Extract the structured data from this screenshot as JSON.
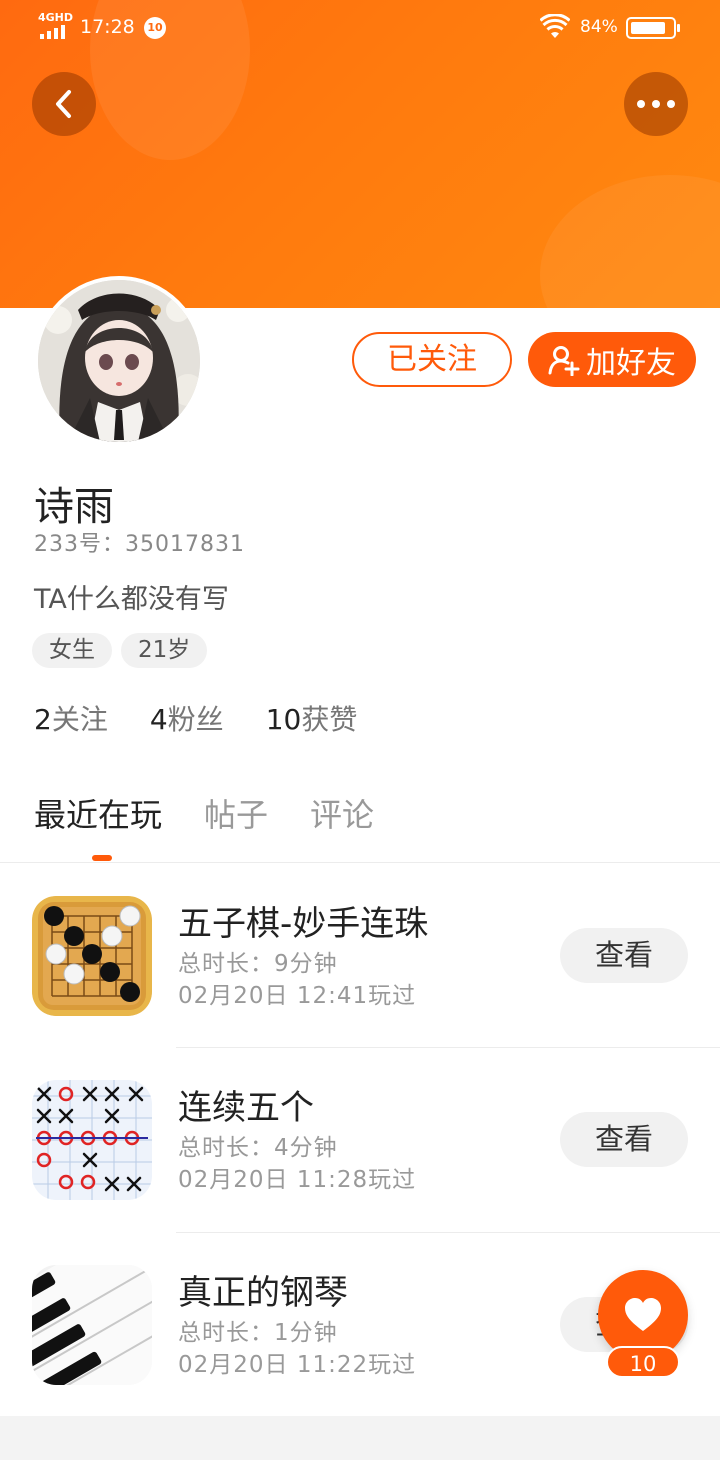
{
  "status_bar": {
    "network": "4GHD",
    "time": "17:28",
    "notification_count": "10",
    "battery_percent": "84%",
    "battery_level": 0.84
  },
  "header": {
    "back_icon": "chevron-left-icon",
    "more_icon": "more-dots-icon",
    "background_color": "#ff7010"
  },
  "profile": {
    "name": "诗雨",
    "uid": "233号：35017831",
    "bio": "TA什么都没有写",
    "tags": [
      "女生",
      "21岁"
    ],
    "followed_label": "已关注",
    "add_friend_label": "加好友",
    "stats": {
      "following_count": "2",
      "following_label": "关注",
      "fans_count": "4",
      "fans_label": "粉丝",
      "likes_count": "10",
      "likes_label": "获赞"
    }
  },
  "tabs": [
    "最近在玩",
    "帖子",
    "评论"
  ],
  "active_tab": "最近在玩",
  "accent_color": "#ff5a0a",
  "games": [
    {
      "title": "五子棋-妙手连珠",
      "duration": "总时长：9分钟",
      "played": "02月20日 12:41玩过",
      "button": "查看",
      "icon": "gomoku-board-icon"
    },
    {
      "title": "连续五个",
      "duration": "总时长：4分钟",
      "played": "02月20日 11:28玩过",
      "button": "查看",
      "icon": "tic-tac-toe-grid-icon"
    },
    {
      "title": "真正的钢琴",
      "duration": "总时长：1分钟",
      "played": "02月20日 11:22玩过",
      "button": "查看",
      "icon": "piano-keys-icon"
    }
  ],
  "like_fab": {
    "icon": "heart-icon",
    "count": "10"
  }
}
